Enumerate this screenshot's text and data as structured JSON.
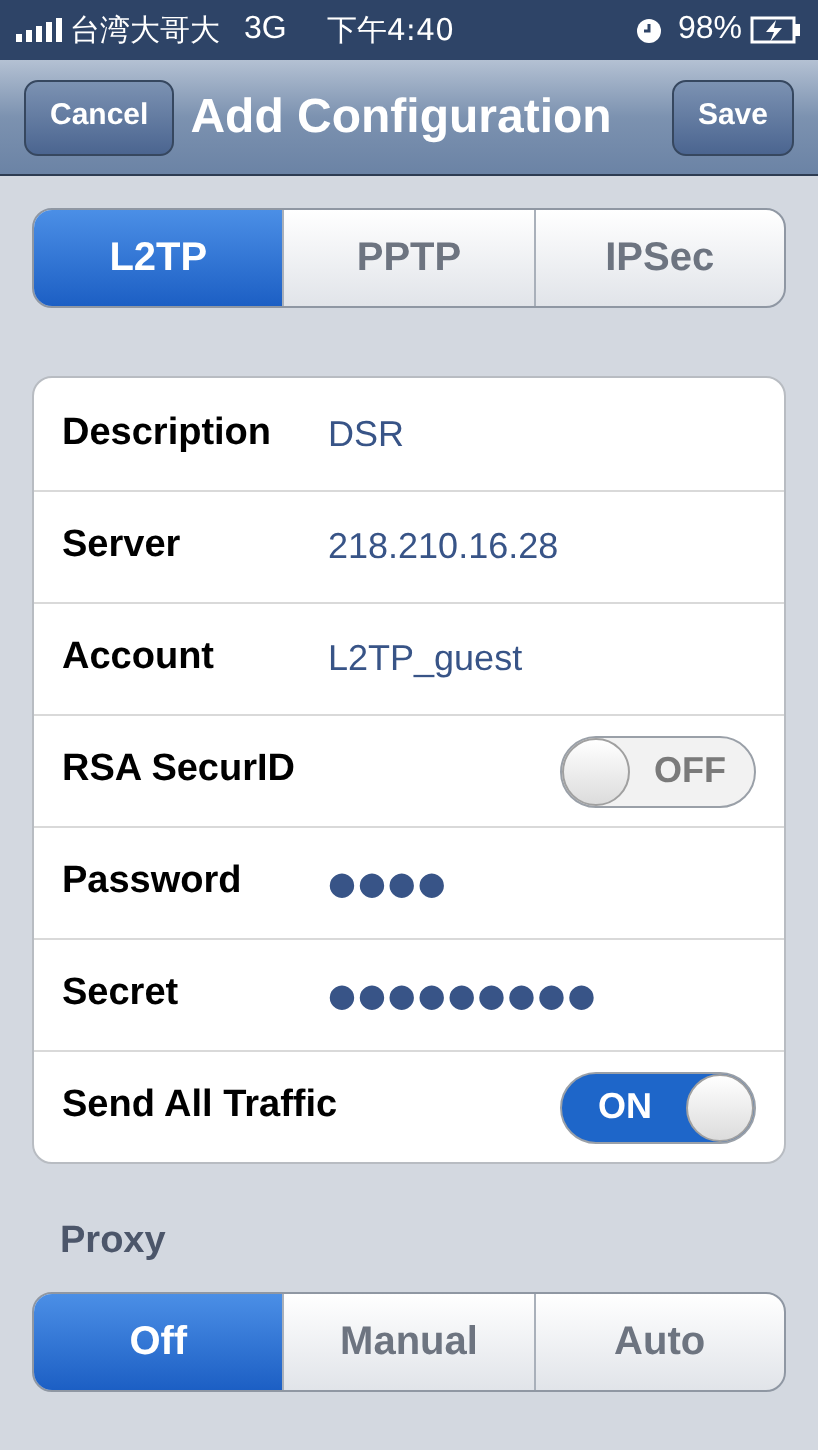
{
  "status_bar": {
    "carrier": "台湾大哥大",
    "network": "3G",
    "time": "下午4:40",
    "battery": "98%"
  },
  "nav": {
    "title": "Add Configuration",
    "left_button": "Cancel",
    "right_button": "Save"
  },
  "protocol_tabs": [
    {
      "label": "L2TP",
      "selected": true
    },
    {
      "label": "PPTP",
      "selected": false
    },
    {
      "label": "IPSec",
      "selected": false
    }
  ],
  "fields": [
    {
      "kind": "text",
      "label": "Description",
      "value": "DSR"
    },
    {
      "kind": "text",
      "label": "Server",
      "value": "218.210.16.28"
    },
    {
      "kind": "text",
      "label": "Account",
      "value": "L2TP_guest"
    },
    {
      "kind": "toggle",
      "label": "RSA SecurID",
      "on": false,
      "state_text": "OFF"
    },
    {
      "kind": "secret",
      "label": "Password",
      "value": "●●●●"
    },
    {
      "kind": "secret",
      "label": "Secret",
      "value": "●●●●●●●●●"
    },
    {
      "kind": "toggle",
      "label": "Send All Traffic",
      "on": true,
      "state_text": "ON"
    }
  ],
  "proxy": {
    "label": "Proxy",
    "options": [
      {
        "label": "Off",
        "selected": true
      },
      {
        "label": "Manual",
        "selected": false
      },
      {
        "label": "Auto",
        "selected": false
      }
    ]
  }
}
